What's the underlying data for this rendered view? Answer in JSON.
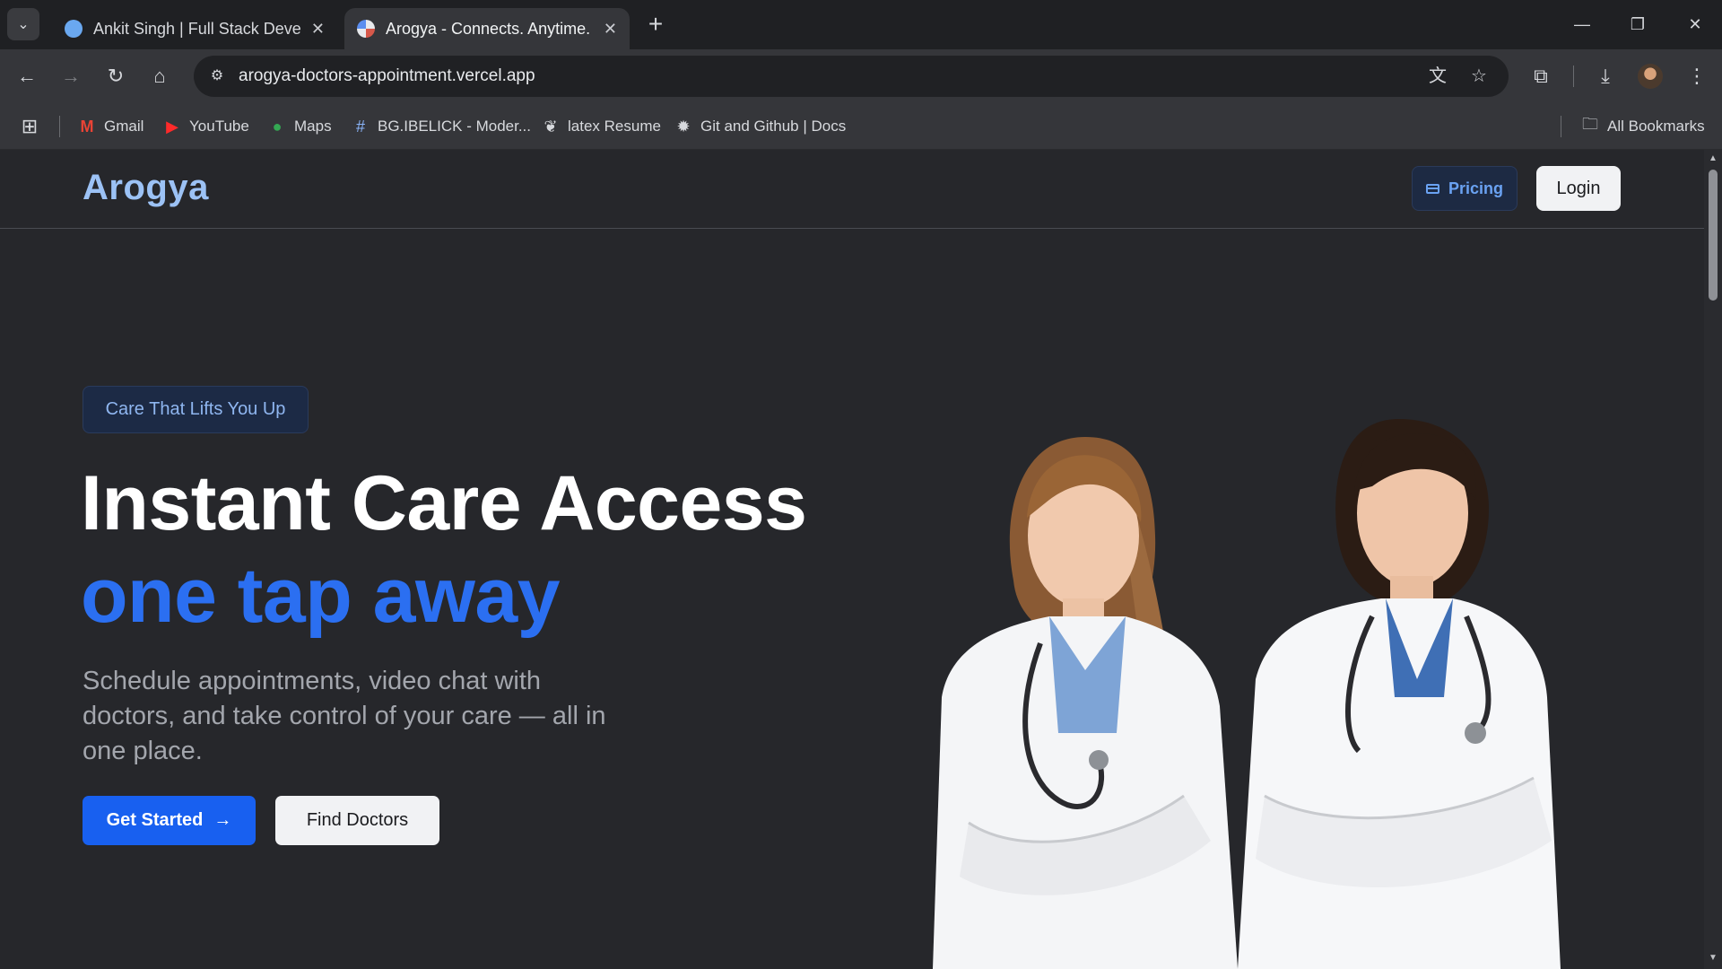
{
  "browser": {
    "tabs": [
      {
        "title": "Ankit Singh | Full Stack Developer",
        "active": false
      },
      {
        "title": "Arogya - Connects. Anytime. Anywhere.",
        "active": true
      }
    ],
    "url": "arogya-doctors-appointment.vercel.app",
    "bookmarks": [
      {
        "label": "Gmail",
        "icon": "gmail-icon"
      },
      {
        "label": "YouTube",
        "icon": "youtube-icon"
      },
      {
        "label": "Maps",
        "icon": "maps-icon"
      },
      {
        "label": "BG.IBELICK - Moder...",
        "icon": "hash-icon"
      },
      {
        "label": "latex Resume",
        "icon": "overleaf-icon"
      },
      {
        "label": "Git and Github | Docs",
        "icon": "gear-icon"
      }
    ],
    "all_bookmarks_label": "All Bookmarks"
  },
  "site": {
    "logo": "Arogya",
    "nav": {
      "pricing_label": "Pricing",
      "login_label": "Login"
    },
    "hero": {
      "badge": "Care That Lifts You Up",
      "headline_line1": "Instant Care Access",
      "headline_line2": "one tap away",
      "subtitle": "Schedule appointments, video chat with doctors, and take control of your care — all in one place.",
      "primary_cta": "Get Started",
      "secondary_cta": "Find Doctors"
    }
  },
  "colors": {
    "accent": "#1860f0",
    "logo": "#9cc2f5",
    "background": "#26272b"
  }
}
